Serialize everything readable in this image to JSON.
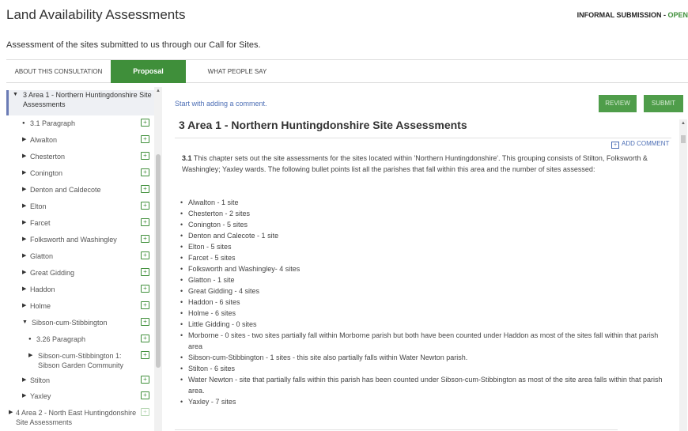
{
  "header": {
    "title": "Land Availability Assessments",
    "status_label": "INFORMAL SUBMISSION",
    "status_sep": " - ",
    "status_value": "OPEN",
    "subtitle": "Assessment of the sites submitted to us through our Call for Sites."
  },
  "tabs": [
    {
      "label": "ABOUT THIS CONSULTATION"
    },
    {
      "label": "Proposal"
    },
    {
      "label": "WHAT PEOPLE SAY"
    }
  ],
  "sidebar": {
    "items": [
      {
        "label": "3 Area 1 - Northern Huntingdonshire Site Assessments",
        "caret": "▼"
      },
      {
        "label": "3.1 Paragraph",
        "caret": "●"
      },
      {
        "label": "Alwalton",
        "caret": "▶"
      },
      {
        "label": "Chesterton",
        "caret": "▶"
      },
      {
        "label": "Conington",
        "caret": "▶"
      },
      {
        "label": "Denton and Caldecote",
        "caret": "▶"
      },
      {
        "label": "Elton",
        "caret": "▶"
      },
      {
        "label": "Farcet",
        "caret": "▶"
      },
      {
        "label": "Folksworth and Washingley",
        "caret": "▶"
      },
      {
        "label": "Glatton",
        "caret": "▶"
      },
      {
        "label": "Great Gidding",
        "caret": "▶"
      },
      {
        "label": "Haddon",
        "caret": "▶"
      },
      {
        "label": "Holme",
        "caret": "▶"
      },
      {
        "label": "Sibson-cum-Stibbington",
        "caret": "▼"
      },
      {
        "label": "3.26 Paragraph",
        "caret": "●"
      },
      {
        "label": "Sibson-cum-Stibbington 1: Sibson Garden Community",
        "caret": "▶"
      },
      {
        "label": "Stilton",
        "caret": "▶"
      },
      {
        "label": "Yaxley",
        "caret": "▶"
      },
      {
        "label": "4 Area 2 - North East Huntingdonshire Site Assessments",
        "caret": "▶"
      }
    ],
    "add_icon": "+"
  },
  "main": {
    "start_text": "Start with adding a comment.",
    "review_label": "REVIEW",
    "submit_label": "SUBMIT",
    "heading": "3 Area 1 - Northern Huntingdonshire Site Assessments",
    "add_comment_label": "ADD COMMENT",
    "para_number": "3.1",
    "para_text": " This chapter sets out the site assessments for the sites located within 'Northern Huntingdonshire'. This grouping consists of Stilton, Folksworth & Washingley; Yaxley wards. The following bullet points list all the parishes that fall within this area and the number of sites assessed:",
    "bullets": [
      "Alwalton - 1 site",
      "Chesterton - 2 sites",
      "Conington - 5 sites",
      "Denton and Calecote - 1 site",
      "Elton - 5 sites",
      "Farcet - 5 sites",
      "Folksworth and Washingley- 4 sites",
      "Glatton - 1 site",
      "Great Gidding - 4 sites",
      "Haddon - 6 sites",
      "Holme - 6 sites",
      "Little Gidding - 0 sites",
      "Morborne - 0 sites - two sites partially fall within Morborne parish but both have been counted under Haddon as most of the sites fall within that parish area",
      "Sibson-cum-Stibbington - 1 sites - this site also partially falls within Water Newton parish.",
      "Stilton - 6 sites",
      "Water Newton - site that partially falls within this parish has been counted under Sibson-cum-Stibbington as most of the site area falls within that parish area.",
      "Yaxley - 7 sites"
    ]
  },
  "colors": {
    "accent_green": "#3f8f3a",
    "link_blue": "#4c6eb5"
  }
}
